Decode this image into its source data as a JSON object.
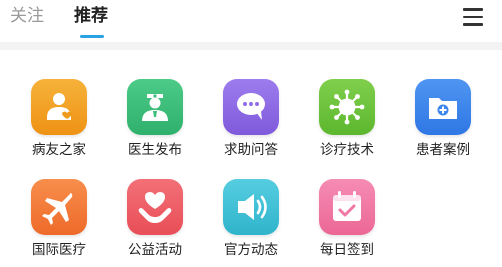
{
  "header": {
    "tabs": [
      {
        "label": "关注",
        "active": false
      },
      {
        "label": "推荐",
        "active": true
      }
    ],
    "menu_icon": "hamburger-menu-icon",
    "accent_color": "#29a3e6"
  },
  "services": [
    {
      "label": "病友之家",
      "icon": "patient-home-icon",
      "color": "#f3a325"
    },
    {
      "label": "医生发布",
      "icon": "doctor-icon",
      "color": "#3cbf7c"
    },
    {
      "label": "求助问答",
      "icon": "chat-bubble-icon",
      "color": "#8f6ce6"
    },
    {
      "label": "诊疗技术",
      "icon": "virus-icon",
      "color": "#6fc43e"
    },
    {
      "label": "患者案例",
      "icon": "folder-plus-icon",
      "color": "#3d86ee"
    },
    {
      "label": "国际医疗",
      "icon": "airplane-icon",
      "color": "#f47b3a"
    },
    {
      "label": "公益活动",
      "icon": "heart-hand-icon",
      "color": "#ee5f67"
    },
    {
      "label": "官方动态",
      "icon": "speaker-icon",
      "color": "#3ec2d6"
    },
    {
      "label": "每日签到",
      "icon": "calendar-check-icon",
      "color": "#f07aa5"
    }
  ]
}
